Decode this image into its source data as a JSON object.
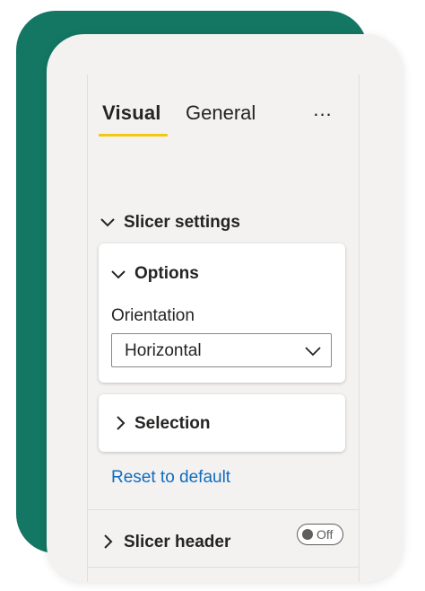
{
  "tabs": [
    {
      "label": "Visual",
      "active": true
    },
    {
      "label": "General",
      "active": false
    }
  ],
  "more_options": "...",
  "slicer_settings": {
    "label": "Slicer settings",
    "expanded": true,
    "options": {
      "label": "Options",
      "expanded": true,
      "orientation": {
        "label": "Orientation",
        "value": "Horizontal"
      }
    },
    "selection": {
      "label": "Selection",
      "expanded": false
    },
    "reset_label": "Reset to default"
  },
  "slicer_header": {
    "label": "Slicer header",
    "expanded": false,
    "toggle_label": "Off",
    "toggle_on": false
  },
  "colors": {
    "back_card": "#137763",
    "active_tab_underline": "#f2c811",
    "link": "#0f6cbd",
    "pane_background": "#f3f2f1"
  },
  "icons": {
    "more": "more-options-icon",
    "expanded": "chevron-down-icon",
    "collapsed": "chevron-right-icon"
  }
}
